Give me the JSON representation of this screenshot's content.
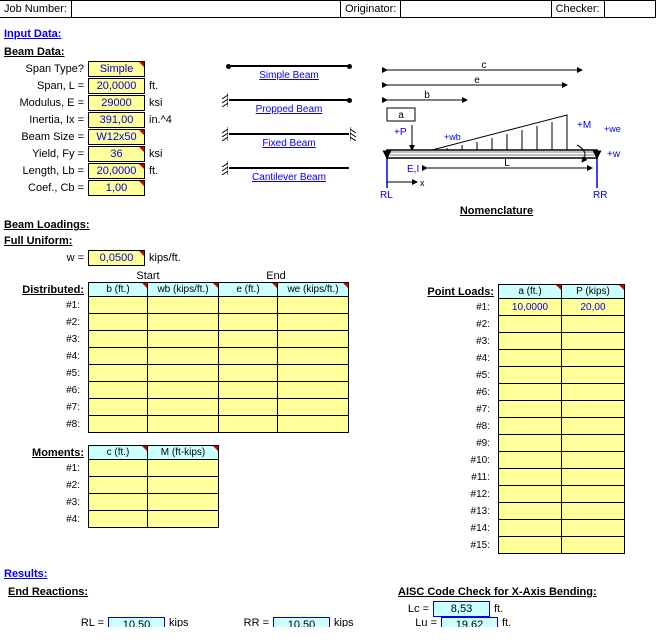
{
  "header": {
    "job_label": "Job Number:",
    "job_value": "",
    "orig_label": "Originator:",
    "orig_value": "",
    "check_label": "Checker:",
    "check_value": ""
  },
  "sections": {
    "input": "Input Data:",
    "beam_data": "Beam Data:",
    "beam_loadings": "Beam Loadings:",
    "full_uniform": "Full Uniform:",
    "distributed": "Distributed:",
    "moments": "Moments:",
    "point_loads": "Point Loads:",
    "results": "Results:",
    "end_reactions": "End Reactions:",
    "aisc": "AISC Code Check for X-Axis Bending:"
  },
  "beam_data": {
    "span_type": {
      "label": "Span Type?",
      "value": "Simple",
      "unit": ""
    },
    "span_l": {
      "label": "Span, L =",
      "value": "20,0000",
      "unit": "ft."
    },
    "modulus": {
      "label": "Modulus, E =",
      "value": "29000",
      "unit": "ksi"
    },
    "inertia": {
      "label": "Inertia, Ix =",
      "value": "391,00",
      "unit": "in.^4"
    },
    "beam_size": {
      "label": "Beam Size =",
      "value": "W12x50",
      "unit": ""
    },
    "yield_fy": {
      "label": "Yield, Fy =",
      "value": "36",
      "unit": "ksi"
    },
    "length_lb": {
      "label": "Length, Lb =",
      "value": "20,0000",
      "unit": "ft."
    },
    "coef_cb": {
      "label": "Coef., Cb =",
      "value": "1,00",
      "unit": ""
    }
  },
  "beam_types": {
    "simple": "Simple Beam",
    "propped": "Propped Beam",
    "fixed": "Fixed Beam",
    "cantilever": "Cantilever Beam"
  },
  "nomenclature": {
    "title": "Nomenclature",
    "c": "c",
    "e": "e",
    "b": "b",
    "a": "a",
    "P": "+P",
    "wb": "+wb",
    "M": "+M",
    "we": "+we",
    "w": "+w",
    "EI": "E,I",
    "L": "L",
    "RL": "RL",
    "RR": "RR",
    "x": "x"
  },
  "full_uniform": {
    "w_label": "w =",
    "w_value": "0,0500",
    "w_unit": "kips/ft."
  },
  "dist_headers": {
    "start": "Start",
    "end": "End",
    "b": "b (ft.)",
    "wb": "wb (kips/ft.)",
    "e": "e (ft.)",
    "we": "we (kips/ft.)"
  },
  "distributed": [
    {
      "b": "",
      "wb": "",
      "e": "",
      "we": ""
    },
    {
      "b": "",
      "wb": "",
      "e": "",
      "we": ""
    },
    {
      "b": "",
      "wb": "",
      "e": "",
      "we": ""
    },
    {
      "b": "",
      "wb": "",
      "e": "",
      "we": ""
    },
    {
      "b": "",
      "wb": "",
      "e": "",
      "we": ""
    },
    {
      "b": "",
      "wb": "",
      "e": "",
      "we": ""
    },
    {
      "b": "",
      "wb": "",
      "e": "",
      "we": ""
    },
    {
      "b": "",
      "wb": "",
      "e": "",
      "we": ""
    }
  ],
  "moments_headers": {
    "c": "c (ft.)",
    "M": "M (ft-kips)"
  },
  "moments": [
    {
      "c": "",
      "M": ""
    },
    {
      "c": "",
      "M": ""
    },
    {
      "c": "",
      "M": ""
    },
    {
      "c": "",
      "M": ""
    }
  ],
  "point_headers": {
    "a": "a (ft.)",
    "P": "P (kips)"
  },
  "point_loads": [
    {
      "a": "10,0000",
      "P": "20,00"
    },
    {
      "a": "",
      "P": ""
    },
    {
      "a": "",
      "P": ""
    },
    {
      "a": "",
      "P": ""
    },
    {
      "a": "",
      "P": ""
    },
    {
      "a": "",
      "P": ""
    },
    {
      "a": "",
      "P": ""
    },
    {
      "a": "",
      "P": ""
    },
    {
      "a": "",
      "P": ""
    },
    {
      "a": "",
      "P": ""
    },
    {
      "a": "",
      "P": ""
    },
    {
      "a": "",
      "P": ""
    },
    {
      "a": "",
      "P": ""
    },
    {
      "a": "",
      "P": ""
    },
    {
      "a": "",
      "P": ""
    }
  ],
  "results": {
    "RL_label": "RL =",
    "RL_value": "10,50",
    "RL_unit": "kips",
    "RR_label": "RR =",
    "RR_value": "10,50",
    "RR_unit": "kips",
    "Lc_label": "Lc =",
    "Lc_value": "8,53",
    "Lc_unit": "ft.",
    "Lu_label": "Lu =",
    "Lu_value": "19,62",
    "Lu_unit": "ft."
  }
}
